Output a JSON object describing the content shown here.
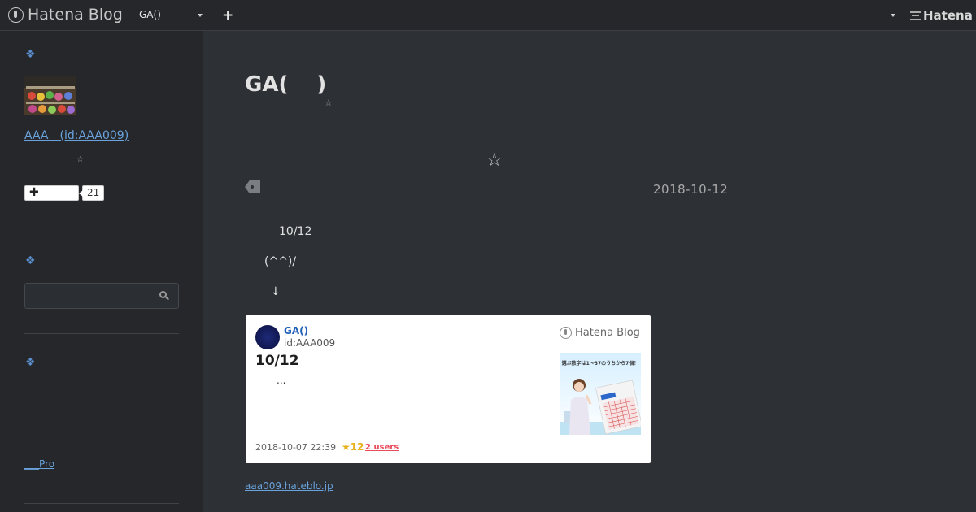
{
  "topbar": {
    "brand": "Hatena Blog",
    "blog_select": "GA()",
    "add_label": "+",
    "hatena_logo": "Hatena"
  },
  "sidebar": {
    "profile_link": "AAA　(id:AAA009)",
    "subscribe_label": "✚",
    "subscriber_count": "21",
    "pro_link": "___Pro"
  },
  "entry": {
    "title": "GA(　 )",
    "date": "2018-10-12",
    "body": [
      "10/12",
      "(^^)/",
      "↓"
    ]
  },
  "card": {
    "blog_name": "GA()",
    "user_id": "id:AAA009",
    "brand": "Hatena Blog",
    "title": "10/12",
    "excerpt": "...",
    "thumb_caption": "選ぶ数字は1～37のうちから7個！",
    "datetime": "2018-10-07 22:39",
    "stars": "12",
    "users": "2 users"
  },
  "footer": {
    "blog_url": "aaa009.hateblo.jp"
  },
  "colors": {
    "background": "#2d3035",
    "sidebar": "#25272b",
    "link": "#6aa3dc",
    "accent_diamond": "#5b8fcf",
    "bookmark_users": "#ea4b5b",
    "star": "#e8b21b"
  }
}
